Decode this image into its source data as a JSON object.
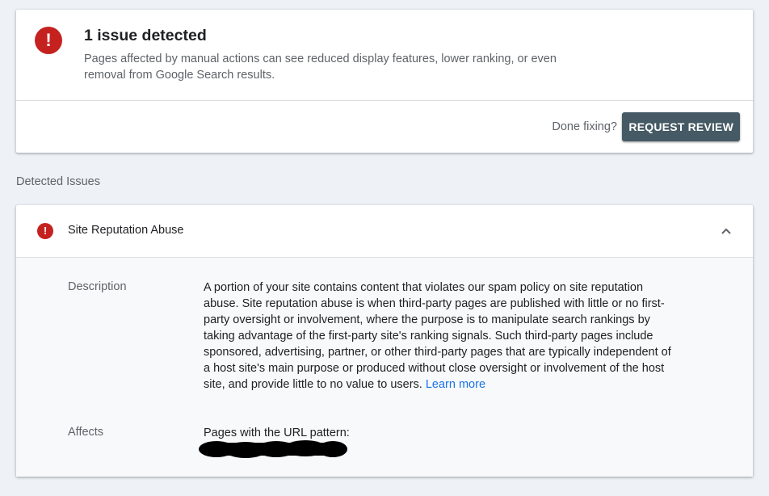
{
  "summary": {
    "title": "1 issue detected",
    "description": "Pages affected by manual actions can see reduced display features, lower ranking, or even removal from Google Search results.",
    "done_text": "Done fixing?",
    "request_button_label": "REQUEST REVIEW",
    "alert_icon": "error-icon"
  },
  "section_label": "Detected Issues",
  "issue": {
    "title": "Site Reputation Abuse",
    "expanded": true,
    "alert_icon": "error-icon",
    "toggle_icon": "chevron-up-icon",
    "description_label": "Description",
    "description_text": "A portion of your site contains content that violates our spam policy on site reputation abuse. Site reputation abuse is when third-party pages are published with little or no first-party oversight or involvement, where the purpose is to manipulate search rankings by taking advantage of the first-party site's ranking signals. Such third-party pages include sponsored, advertising, partner, or other third-party pages that are typically independent of a host site's main purpose or produced without close oversight or involvement of the host site, and provide little to no value to users. ",
    "learn_more_label": "Learn more",
    "affects_label": "Affects",
    "affects_text": "Pages with the URL pattern:"
  },
  "colors": {
    "background": "#eef2f6",
    "error": "#c5221f",
    "button": "#455a64",
    "link": "#1a73e8",
    "body_panel": "#f8f9fa"
  }
}
